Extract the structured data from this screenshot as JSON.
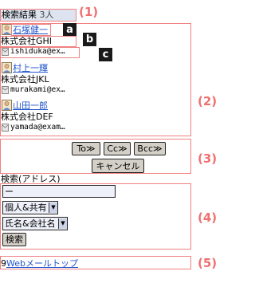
{
  "header": {
    "title": "検索結果",
    "count": "3人"
  },
  "results": [
    {
      "name": "石塚健一",
      "company": "株式会社GHI",
      "email": "ishiduka@ex…"
    },
    {
      "name": "村上一輝",
      "company": "株式会社JKL",
      "email": "murakami@ex…"
    },
    {
      "name": "山田一郎",
      "company": "株式会社DEF",
      "email": "yamada@exam…"
    }
  ],
  "buttons": {
    "to": "To≫",
    "cc": "Cc≫",
    "bcc": "Bcc≫",
    "cancel": "キャンセル"
  },
  "search": {
    "label": "検索(アドレス)",
    "input_value": "ー",
    "scope_select": "個人&共有",
    "field_select": "氏名&会社名",
    "submit": "検索"
  },
  "footer": {
    "number": "9",
    "link": "Webメールトップ"
  },
  "annotations": {
    "sections": [
      "(1)",
      "(2)",
      "(3)",
      "(4)",
      "(5)"
    ],
    "badges": [
      "a",
      "b",
      "c"
    ]
  },
  "colors": {
    "annotation": "#f07070",
    "link": "#2255cc",
    "header_bg": "#dde4ef",
    "button_bg": "#d4d0c8"
  }
}
